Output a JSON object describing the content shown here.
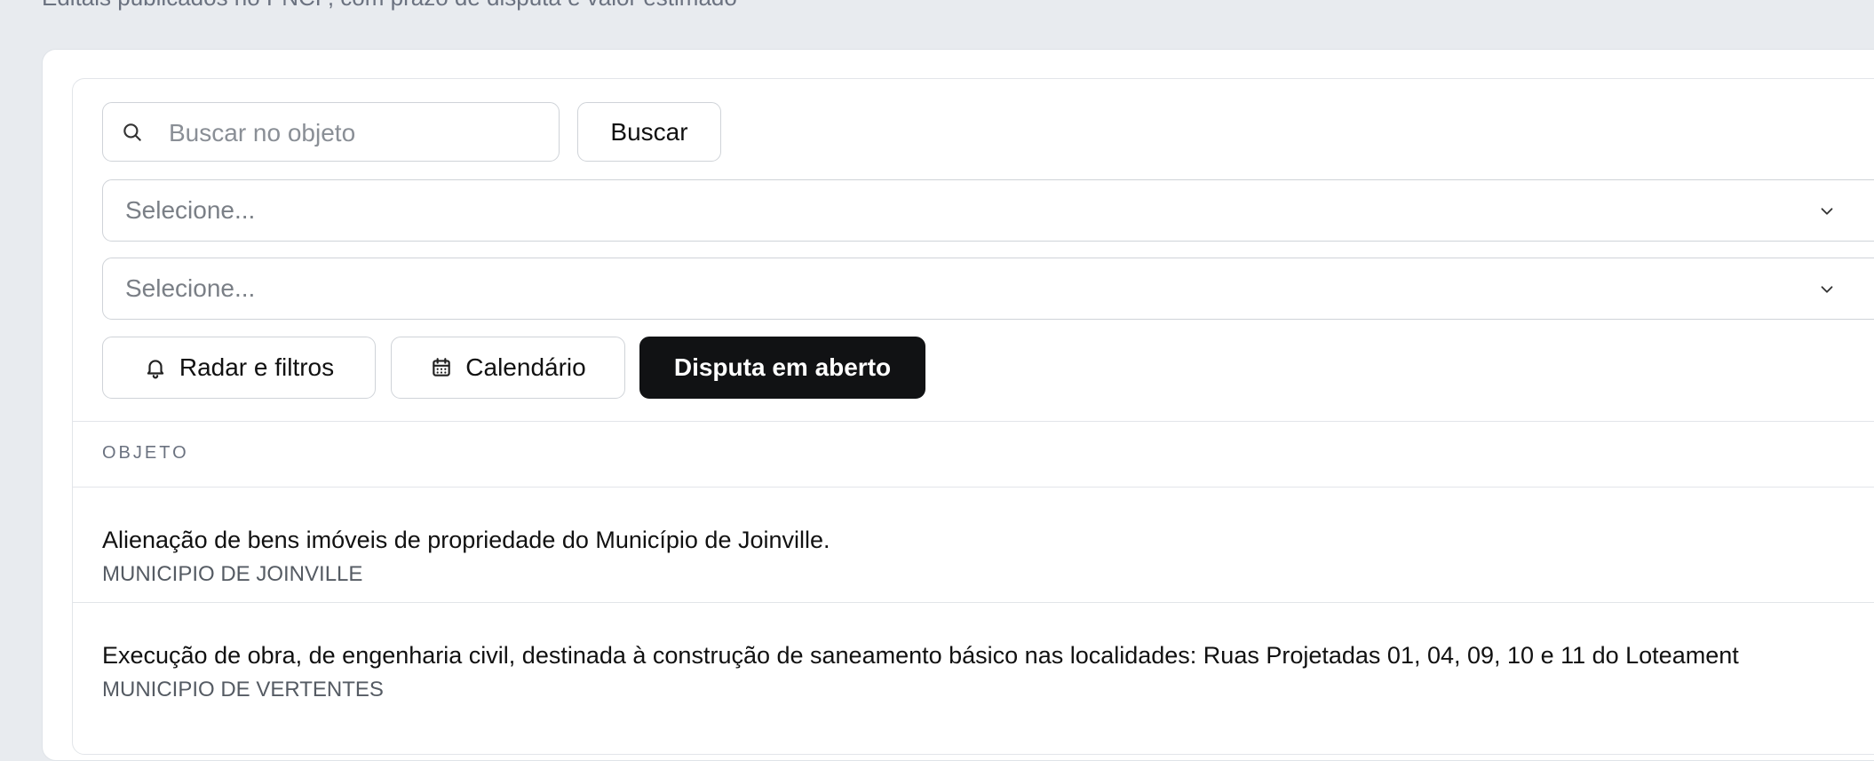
{
  "header": {
    "subtitle": "Editais publicados no PNCP, com prazo de disputa e valor estimado"
  },
  "search": {
    "placeholder": "Buscar no objeto",
    "value": "",
    "button_label": "Buscar"
  },
  "filters": [
    {
      "placeholder": "Selecione..."
    },
    {
      "placeholder": "Selecione..."
    }
  ],
  "actions": {
    "radar_label": "Radar e filtros",
    "calendar_label": "Calendário",
    "disputa_label": "Disputa em aberto"
  },
  "table": {
    "column_header": "OBJETO",
    "rows": [
      {
        "title": "Alienação de bens imóveis de propriedade do Município de Joinville.",
        "org": "MUNICIPIO DE JOINVILLE"
      },
      {
        "title": "Execução de obra, de engenharia civil, destinada à construção de saneamento básico nas localidades: Ruas Projetadas 01, 04, 09, 10 e 11 do Loteament",
        "org": "MUNICIPIO DE VERTENTES"
      }
    ]
  },
  "icons": {
    "search": "search-icon",
    "chevron": "chevron-down-icon",
    "bell": "bell-icon",
    "calendar": "calendar-icon"
  },
  "colors": {
    "background": "#e8ebef",
    "primary_button": "#111214",
    "border": "#cfd3d8"
  }
}
